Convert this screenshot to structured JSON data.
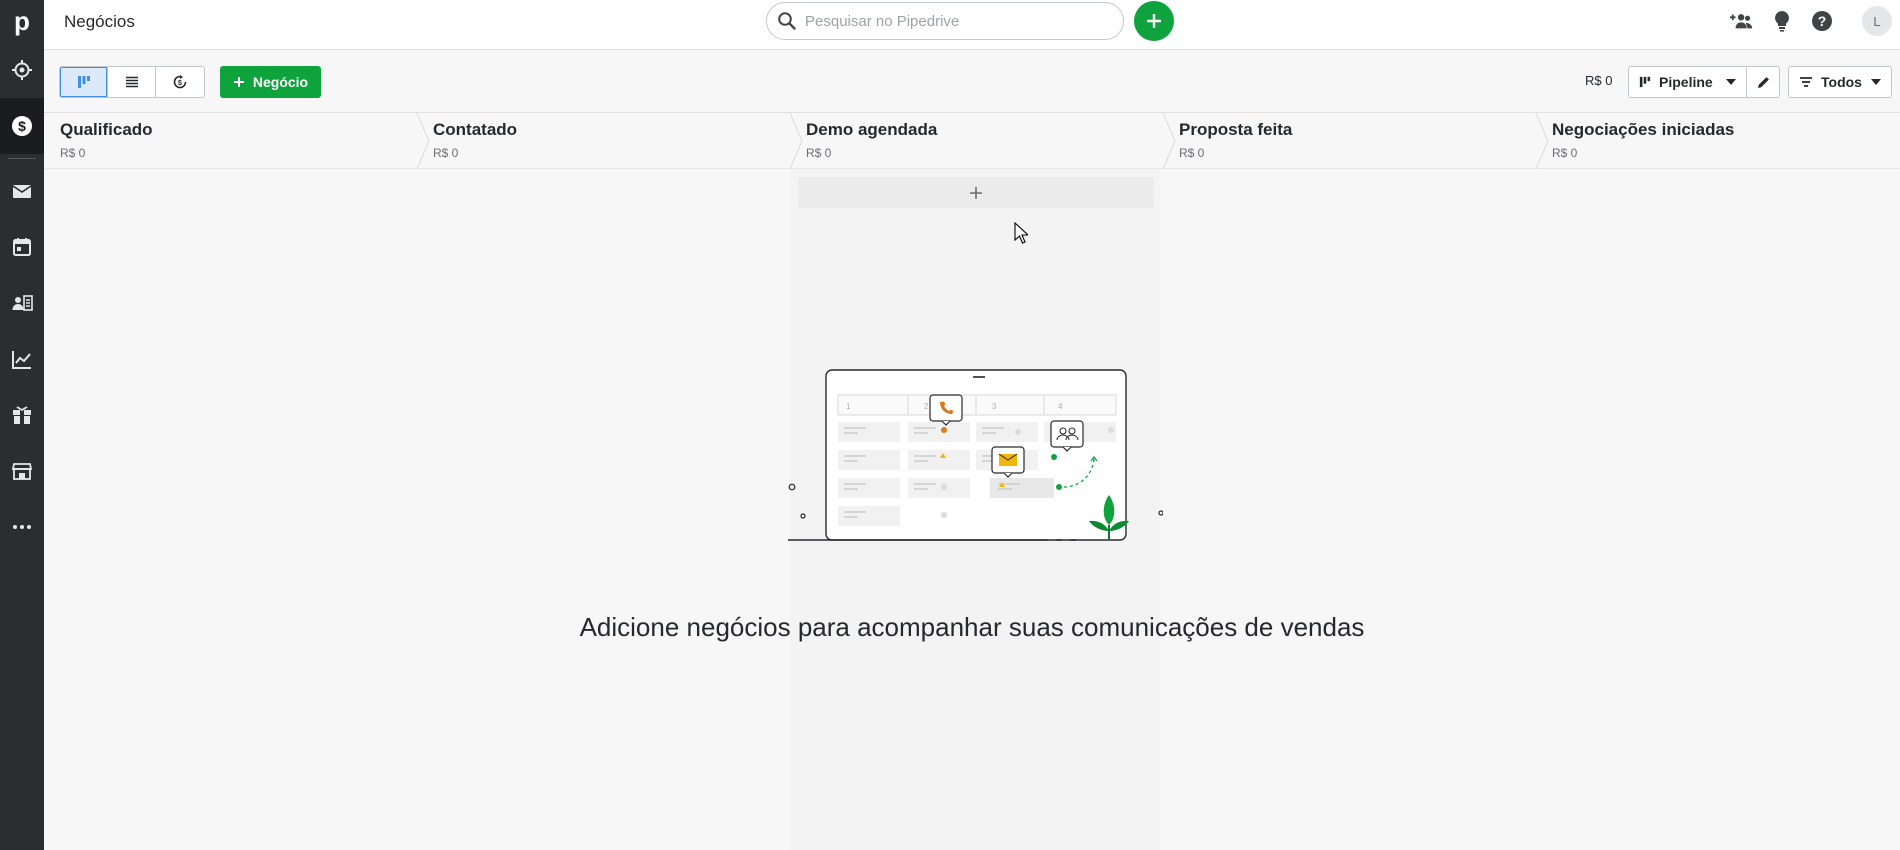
{
  "app": {
    "logo_letter": "p"
  },
  "topbar": {
    "title": "Negócios",
    "search_placeholder": "Pesquisar no Pipedrive",
    "avatar_initial": "L"
  },
  "toolbar": {
    "new_deal_label": "Negócio",
    "total_value": "R$ 0",
    "pipeline_label": "Pipeline",
    "filter_label": "Todos"
  },
  "stages": [
    {
      "name": "Qualificado",
      "value": "R$ 0"
    },
    {
      "name": "Contatado",
      "value": "R$ 0"
    },
    {
      "name": "Demo agendada",
      "value": "R$ 0"
    },
    {
      "name": "Proposta feita",
      "value": "R$ 0"
    },
    {
      "name": "Negociações iniciadas",
      "value": "R$ 0"
    }
  ],
  "empty_state": {
    "message": "Adicione negócios para acompanhar suas comunicações de vendas",
    "illustration_columns": [
      "1",
      "2",
      "3",
      "4"
    ]
  },
  "colors": {
    "brand_green": "#0ea33c",
    "sidebar_bg": "#2b2e31",
    "active_view": "#3f8ee8"
  }
}
